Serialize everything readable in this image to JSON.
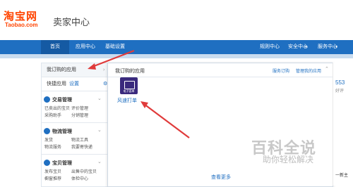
{
  "header": {
    "logo_cn": "淘宝网",
    "logo_en": "Taobao.com",
    "title": "卖家中心"
  },
  "nav": {
    "left": [
      "首页",
      "应用中心",
      "基础设置"
    ],
    "right": [
      "规则中心",
      "安全中心",
      "服务中心"
    ]
  },
  "sidebar": {
    "my_apps": "我订购的应用",
    "quick_apps": "快捷应用",
    "settings_link": "设置",
    "categories": [
      {
        "title": "交易管理",
        "items": [
          "已卖出的宝贝",
          "评价管理",
          "采购助手",
          "分销管理"
        ]
      },
      {
        "title": "物流管理",
        "items": [
          "发货",
          "物流工具",
          "物流服务",
          "我要寄快递"
        ]
      },
      {
        "title": "宝贝管理",
        "items": [
          "发布宝贝",
          "出售中的宝贝",
          "橱窗推荐",
          "体检中心"
        ]
      }
    ]
  },
  "popup": {
    "title": "我订购的应用",
    "links": [
      "服务订购",
      "管理我的应用"
    ],
    "app_icon_label": "电子面单",
    "app_name": "风速打单",
    "view_more": "查看更多"
  },
  "right_partial": {
    "number": "553",
    "text": "好评",
    "bottom": "一新主"
  },
  "watermark": {
    "title": "百科全说",
    "subtitle": "助你轻松解决"
  },
  "colors": {
    "brand": "#ff4400",
    "nav": "#1f6fc1",
    "arrow": "#e03b3b"
  }
}
